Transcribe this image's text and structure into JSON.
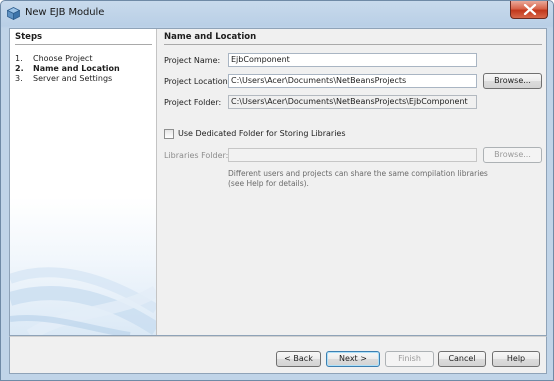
{
  "window": {
    "title": "New EJB Module",
    "close_icon": "close-icon"
  },
  "steps": {
    "title": "Steps",
    "items": [
      {
        "num": "1.",
        "label": "Choose Project",
        "current": false
      },
      {
        "num": "2.",
        "label": "Name and Location",
        "current": true
      },
      {
        "num": "3.",
        "label": "Server and Settings",
        "current": false
      }
    ]
  },
  "main": {
    "section_title": "Name and Location",
    "project_name_label": "Project Name:",
    "project_name_value": "EjbComponent",
    "project_location_label": "Project Location:",
    "project_location_value": "C:\\Users\\Acer\\Documents\\NetBeansProjects",
    "project_folder_label": "Project Folder:",
    "project_folder_value": "C:\\Users\\Acer\\Documents\\NetBeansProjects\\EjbComponent",
    "browse_label": "Browse...",
    "dedicated_folder_label": "Use Dedicated Folder for Storing Libraries",
    "dedicated_folder_checked": false,
    "libraries_folder_label": "Libraries Folder:",
    "libraries_folder_value": "",
    "libraries_browse_label": "Browse...",
    "hint_text": "Different users and projects can share the same compilation libraries (see Help for details)."
  },
  "footer": {
    "back_label": "< Back",
    "next_label": "Next >",
    "finish_label": "Finish",
    "cancel_label": "Cancel",
    "help_label": "Help"
  },
  "colors": {
    "title_bar": "#c8daec",
    "close_button": "#c2381c",
    "panel_bg": "#f0f0f0",
    "default_button_border": "#3c7fb1"
  }
}
